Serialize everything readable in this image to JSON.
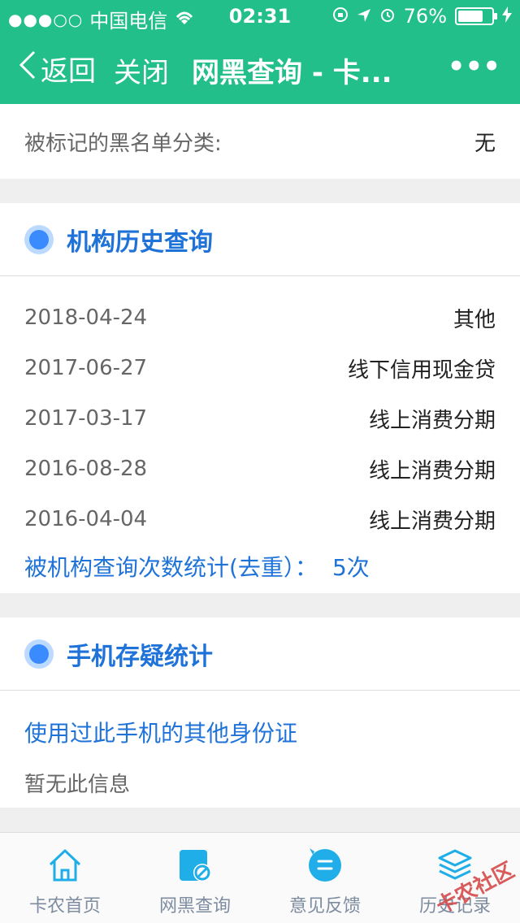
{
  "status_bar": {
    "signal_dots": "●●●○○",
    "carrier": "中国电信",
    "time": "02:31",
    "battery_percent": "76%",
    "battery_level": 0.76
  },
  "nav": {
    "back_label": "返回",
    "close_label": "关闭",
    "title": "网黑查询 - 卡...",
    "more_label": "•••"
  },
  "blacklist": {
    "label": "被标记的黑名单分类:",
    "value": "无"
  },
  "institution_history": {
    "title": "机构历史查询",
    "rows": [
      {
        "date": "2018-04-24",
        "type": "其他"
      },
      {
        "date": "2017-06-27",
        "type": "线下信用现金贷"
      },
      {
        "date": "2017-03-17",
        "type": "线上消费分期"
      },
      {
        "date": "2016-08-28",
        "type": "线上消费分期"
      },
      {
        "date": "2016-04-04",
        "type": "线上消费分期"
      }
    ],
    "summary_label": "被机构查询次数统计(去重）：",
    "summary_value": "5次"
  },
  "phone_stats": {
    "title": "手机存疑统计",
    "link_label": "使用过此手机的其他身份证",
    "empty_text": "暂无此信息"
  },
  "tabs": [
    {
      "label": "卡农首页",
      "icon": "home-icon"
    },
    {
      "label": "网黑查询",
      "icon": "blacklist-query-icon"
    },
    {
      "label": "意见反馈",
      "icon": "feedback-icon"
    },
    {
      "label": "历史记录",
      "icon": "history-icon"
    }
  ],
  "watermark": "卡农社区",
  "colors": {
    "header": "#22bf8b",
    "accent_blue": "#1f73d8",
    "tab_icon": "#1faee8"
  }
}
